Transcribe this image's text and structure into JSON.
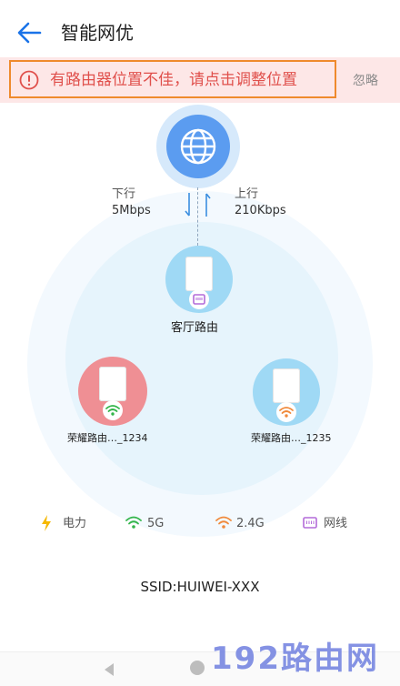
{
  "header": {
    "title": "智能网优"
  },
  "banner": {
    "message": "有路由器位置不佳，请点击调整位置",
    "ignore_label": "忽略"
  },
  "network": {
    "downlink": {
      "label": "下行",
      "value": "5Mbps"
    },
    "uplink": {
      "label": "上行",
      "value": "210Kbps"
    },
    "nodes": [
      {
        "name": "客厅路由",
        "connection": "网线",
        "status_color": "#9fd9f5"
      },
      {
        "name": "荣耀路由…_1234",
        "connection": "5G",
        "status_color": "#ef8f94"
      },
      {
        "name": "荣耀路由…_1235",
        "connection": "2.4G",
        "status_color": "#9fd9f5"
      }
    ]
  },
  "legend": [
    {
      "label": "电力",
      "icon": "lightning-icon",
      "color": "#f5b800"
    },
    {
      "label": "5G",
      "icon": "wifi-icon",
      "color": "#33b54a"
    },
    {
      "label": "2.4G",
      "icon": "wifi-icon",
      "color": "#f08a3c"
    },
    {
      "label": "网线",
      "icon": "ethernet-port-icon",
      "color": "#b36bd9"
    }
  ],
  "ssid": "SSID:HUIWEI-XXX",
  "watermark": "192路由网",
  "colors": {
    "accent": "#1a73e8",
    "warning": "#e0504c",
    "banner_border": "#ef8a2d"
  }
}
